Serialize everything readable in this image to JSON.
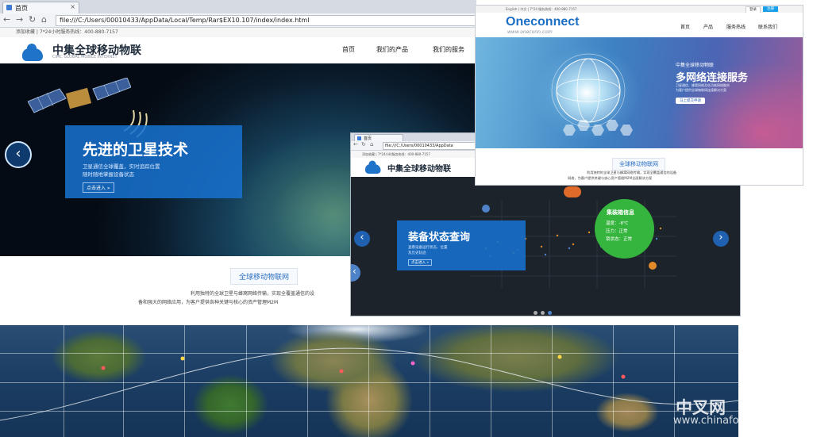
{
  "window1": {
    "tab_title": "首页",
    "url": "file:///C:/Users/00010433/AppData/Local/Temp/Rar$EX10.107/index/index.html",
    "topline": "添加收藏 | 7*24小时服务热线：400-880-7157",
    "brand_cn": "中集全球移动物联",
    "brand_en": "CIMC GLOBAL MOBILE INTERNET",
    "nav": [
      "首页",
      "我们的产品",
      "我们的服务"
    ],
    "hero": {
      "title": "先进的卫星技术",
      "desc_line1": "卫星通信全球覆盖，实时追踪位置",
      "desc_line2": "随时随地掌握设备状态",
      "more": "点击进入 »",
      "prev": "‹"
    },
    "section_title": "全球移动物联网",
    "para_line1": "利用独特的全球卫星与蜂窝网络传输，实现全覆盖通信的设",
    "para_line2": "备和强大的网络应用，为客户提供各种关键与核心的资产管理M2M"
  },
  "window2": {
    "tab_title": "首页",
    "url": "file:///C:/Users/00010433/AppData",
    "topline": "添加收藏 | 7*24小时服务热线：400-880-7157",
    "brand_cn": "中集全球移动物联",
    "hero": {
      "title": "装备状态查询",
      "desc_line1": "查看设备运行状态、位置",
      "desc_line2": "及历史轨迹",
      "more": "点击进入 »"
    },
    "bubble": {
      "title": "集装箱信息",
      "line1": "温度：-8℃",
      "line2": "压力：正常",
      "line3": "锁状态：正常"
    },
    "prev": "‹",
    "next": "›"
  },
  "window3": {
    "topbar": "English | 中文 | 7*24 服务热线：400-880-7157",
    "login": "登录",
    "register": "注册",
    "brand": "Oneconnect",
    "domain": "www.oneconn.com",
    "nav": [
      "首页",
      "产品",
      "服务热线",
      "联系我们"
    ],
    "hero": {
      "subtitle": "中集全球移动物联",
      "title": "多网络连接服务",
      "desc_line1": "卫星通信、蜂窝网络及低功耗网络融合",
      "desc_line2": "为客户提供全球物联网连接解决方案",
      "button": "马上提交申请"
    },
    "section_title": "全球移动物联网",
    "para_line1": "利用独特的全球卫星与蜂窝网络传输，实现全覆盖通信的设备",
    "para_line2": "网络，为客户提供关键与核心资产管理M2M全面解决方案"
  },
  "watermark": {
    "cn": "中叉网",
    "en": "www.chinaforklift.com"
  }
}
